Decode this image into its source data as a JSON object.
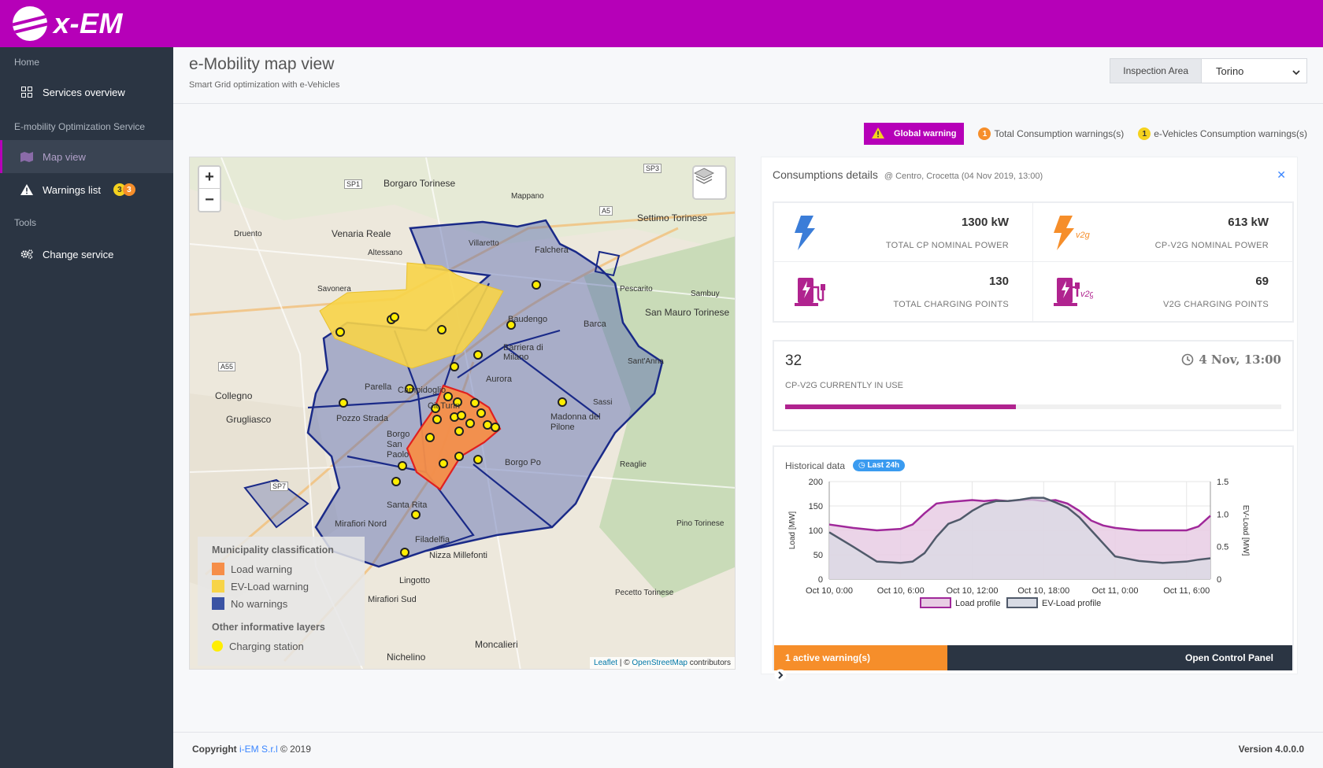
{
  "app": {
    "name": "x-EM"
  },
  "sidebar": {
    "sections": [
      {
        "label": "Home",
        "items": [
          {
            "label": "Services overview",
            "icon": "grid-icon"
          }
        ]
      },
      {
        "label": "E-mobility Optimization Service",
        "items": [
          {
            "label": "Map view",
            "icon": "map-icon",
            "active": true
          },
          {
            "label": "Warnings list",
            "icon": "warning-icon",
            "badges": [
              "3",
              "3"
            ]
          }
        ]
      },
      {
        "label": "Tools",
        "items": [
          {
            "label": "Change service",
            "icon": "cogs-icon"
          }
        ]
      }
    ]
  },
  "page": {
    "title": "e-Mobility map view",
    "subtitle": "Smart Grid optimization with e-Vehicles"
  },
  "inspection": {
    "label": "Inspection Area",
    "value": "Torino"
  },
  "warnings": {
    "global_label": "Global warning",
    "total_count": "1",
    "total_label": "Total Consumption warnings(s)",
    "ev_count": "1",
    "ev_label": "e-Vehicles Consumption warnings(s)"
  },
  "map": {
    "zoom_in": "+",
    "zoom_out": "−",
    "labels": [
      "Borgaro Torinese",
      "Mappano",
      "Settimo Torinese",
      "Venaria Reale",
      "Druento",
      "Altessano",
      "Villaretto",
      "Falchera",
      "Savonera",
      "Pescarito",
      "San Mauro Torinese",
      "Sambuy",
      "Barca",
      "Baudengo",
      "Barriera di Milano",
      "Aurora",
      "Collegno",
      "Grugliasco",
      "Parella",
      "Campidoglio",
      "Cit Turin",
      "Pozzo Strada",
      "Borgo San Paolo",
      "Madonna del Pilone",
      "Reaglie",
      "Borgo Po",
      "Santa Rita",
      "Mirafiori Nord",
      "Filadelfia",
      "Nizza Millefonti",
      "Lingotto",
      "Mirafiori Sud",
      "Pino Torinese",
      "Pecetto Torinese",
      "Moncalieri",
      "Nichelino",
      "Sassi",
      "Sant'Anna"
    ],
    "roads": [
      "SP1",
      "SP3",
      "A5",
      "A55",
      "SP7"
    ],
    "legend": {
      "title": "Municipality classification",
      "items": [
        {
          "label": "Load warning",
          "color": "#f68e48"
        },
        {
          "label": "EV-Load warning",
          "color": "#f7d448"
        },
        {
          "label": "No warnings",
          "color": "#3a53a4"
        }
      ],
      "other_title": "Other informative layers",
      "other_items": [
        {
          "label": "Charging station",
          "color": "#ffee00"
        }
      ]
    },
    "attribution": {
      "leaflet": "Leaflet",
      "sep": " | © ",
      "osm": "OpenStreetMap",
      "suffix": " contributors"
    }
  },
  "details": {
    "title": "Consumptions details",
    "context": "@ Centro, Crocetta (04 Nov 2019, 13:00)",
    "close": "✕",
    "kpis": [
      {
        "value": "1300 kW",
        "label": "TOTAL CP NOMINAL POWER",
        "icon": "bolt-icon"
      },
      {
        "value": "613 kW",
        "label": "CP-V2G NOMINAL POWER",
        "icon": "bolt-v2g-icon",
        "tag": "v2g"
      },
      {
        "value": "130",
        "label": "TOTAL CHARGING POINTS",
        "icon": "charger-icon"
      },
      {
        "value": "69",
        "label": "V2G CHARGING POINTS",
        "icon": "charger-v2g-icon",
        "tag": "v2g"
      }
    ],
    "in_use": {
      "value": "32",
      "label": "CP-V2G CURRENTLY IN USE",
      "time": "4 Nov, 13:00",
      "fraction": 0.465
    },
    "historical": {
      "title": "Historical data",
      "pill": "Last 24h",
      "active_warnings": "1 active warning(s)",
      "open_panel": "Open Control Panel"
    }
  },
  "chart_data": {
    "type": "line",
    "x_ticks": [
      "Oct 10, 0:00",
      "Oct 10, 6:00",
      "Oct 10, 12:00",
      "Oct 10, 18:00",
      "Oct 11, 0:00",
      "Oct 11, 6:00"
    ],
    "ylabel": "Load [MW]",
    "y2label": "EV-Load [MW]",
    "ylim": [
      0,
      200
    ],
    "y_ticks": [
      0,
      50,
      100,
      150,
      200
    ],
    "y2lim": [
      0,
      1.5
    ],
    "y2_ticks": [
      "0",
      "0.5",
      "1.0",
      "1.5"
    ],
    "x_hours": [
      0,
      2,
      4,
      6,
      7,
      8,
      9,
      10,
      11,
      12,
      13,
      14,
      15,
      16,
      17,
      18,
      19,
      20,
      21,
      22,
      23,
      24,
      26,
      28,
      30,
      31,
      32
    ],
    "series": [
      {
        "name": "Load profile",
        "axis": "left",
        "color": "#a0289a",
        "fill": "#e8cde4",
        "values": [
          112,
          105,
          100,
          103,
          112,
          135,
          155,
          158,
          160,
          162,
          160,
          162,
          160,
          162,
          163,
          160,
          162,
          155,
          140,
          120,
          110,
          105,
          100,
          100,
          100,
          108,
          130
        ]
      },
      {
        "name": "EV-Load profile",
        "axis": "right",
        "color": "#505a6a",
        "fill": "#d8dbe4",
        "values": [
          0.72,
          0.5,
          0.27,
          0.25,
          0.27,
          0.4,
          0.65,
          0.85,
          0.92,
          1.05,
          1.15,
          1.2,
          1.2,
          1.22,
          1.25,
          1.25,
          1.18,
          1.1,
          0.95,
          0.75,
          0.55,
          0.35,
          0.28,
          0.25,
          0.27,
          0.3,
          0.32
        ]
      }
    ]
  },
  "footer": {
    "copyright_prefix": "Copyright ",
    "company": "i-EM S.r.l",
    "copyright_suffix": " © 2019",
    "version": "Version 4.0.0.0"
  }
}
